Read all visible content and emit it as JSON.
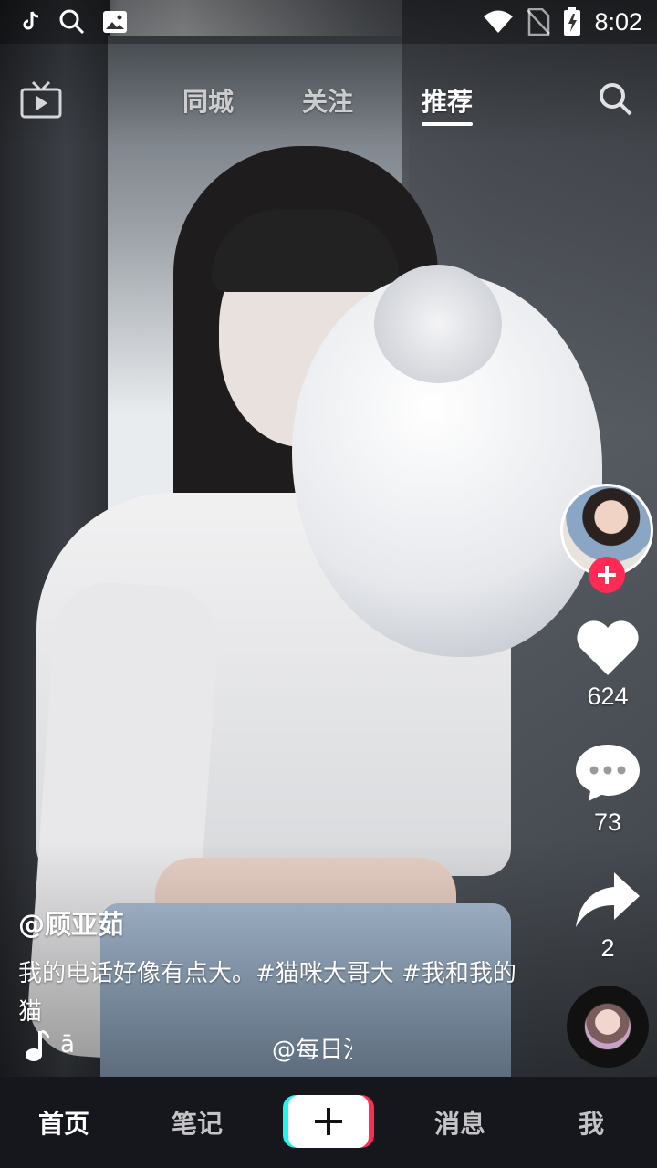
{
  "status_bar": {
    "left_icons": [
      "tiktok-note-icon",
      "search-icon",
      "image-icon"
    ],
    "right_icons": [
      "wifi-icon",
      "no-sim-icon",
      "battery-charging-icon"
    ],
    "time": "8:02"
  },
  "top_nav": {
    "live_icon": "tv-icon",
    "tabs": [
      {
        "label": "同城",
        "active": false
      },
      {
        "label": "关注",
        "active": false
      },
      {
        "label": "推荐",
        "active": true
      }
    ],
    "search_icon": "search-icon"
  },
  "actions": {
    "follow_icon": "plus-icon",
    "like": {
      "icon": "heart-icon",
      "count": "624"
    },
    "comment": {
      "icon": "comment-icon",
      "count": "73"
    },
    "share": {
      "icon": "share-icon",
      "count": "2"
    }
  },
  "caption": {
    "author": "@顾亚茹",
    "description": "我的电话好像有点大。#猫咪大哥大 #我和我的猫",
    "music_left": "ā",
    "music_right": "@每日沙"
  },
  "bottom_nav": {
    "items": [
      {
        "label": "首页",
        "active": true
      },
      {
        "label": "笔记",
        "active": false
      },
      {
        "label": "消息",
        "active": false
      },
      {
        "label": "我",
        "active": false
      }
    ],
    "create_icon": "plus-icon"
  },
  "colors": {
    "accent_red": "#fe2c55",
    "accent_cyan": "#25f4ee",
    "nav_background": "#16171d"
  }
}
